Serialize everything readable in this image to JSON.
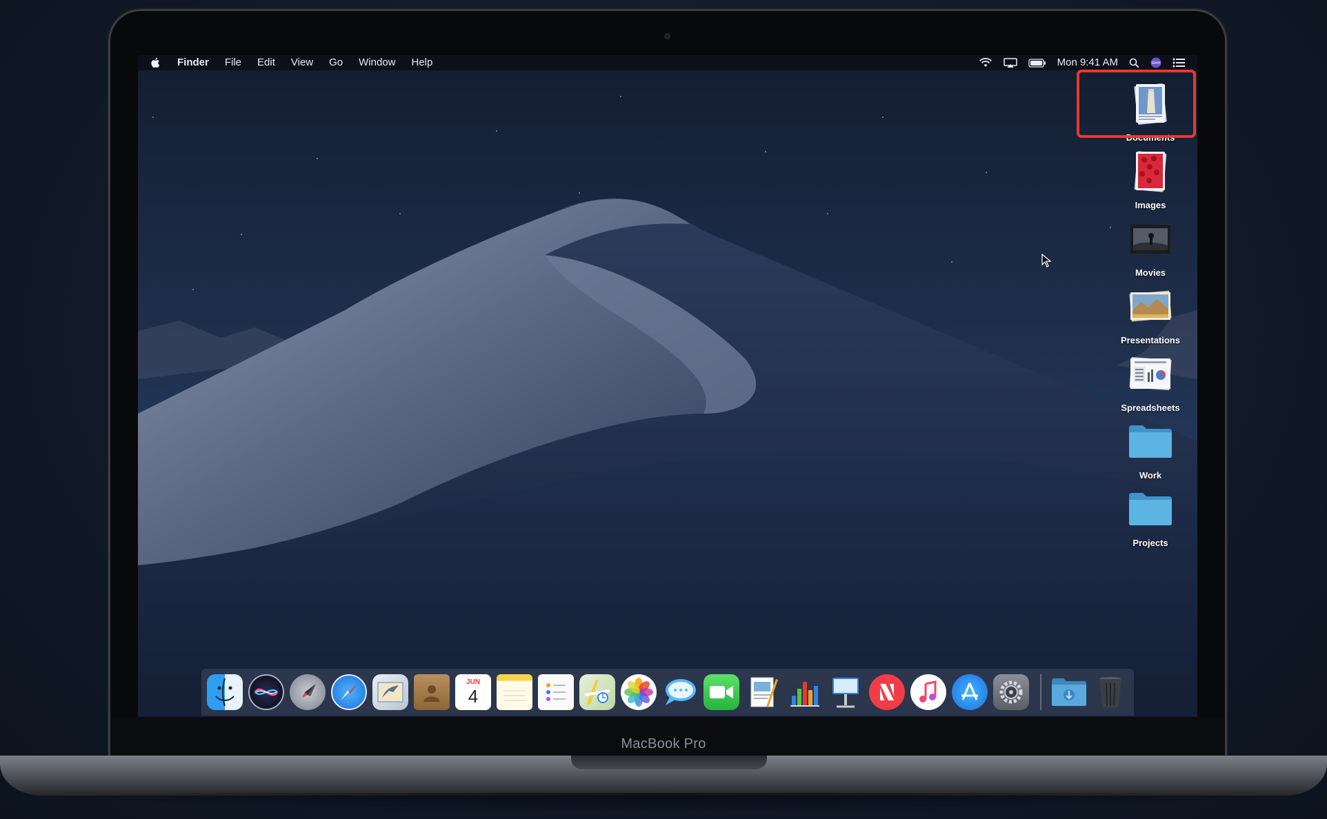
{
  "menubar": {
    "apple_icon": "apple-logo-icon",
    "app_name": "Finder",
    "menus": [
      "File",
      "Edit",
      "View",
      "Go",
      "Window",
      "Help"
    ],
    "status_icons": [
      "wifi-icon",
      "airplay-icon",
      "battery-icon"
    ],
    "clock": "Mon 9:41 AM",
    "right_icons": [
      "spotlight-search-icon",
      "siri-icon",
      "notification-center-icon"
    ]
  },
  "desktop": {
    "items": [
      {
        "label": "Documents",
        "icon": "documents-stack-icon",
        "selected": true
      },
      {
        "label": "Images",
        "icon": "images-stack-icon"
      },
      {
        "label": "Movies",
        "icon": "movies-stack-icon"
      },
      {
        "label": "Presentations",
        "icon": "presentations-stack-icon"
      },
      {
        "label": "Spreadsheets",
        "icon": "spreadsheets-stack-icon"
      },
      {
        "label": "Work",
        "icon": "folder-icon"
      },
      {
        "label": "Projects",
        "icon": "folder-icon"
      }
    ],
    "highlight_color": "#e8392a"
  },
  "dock": {
    "apps": [
      "finder-icon",
      "siri-icon",
      "launchpad-icon",
      "safari-icon",
      "mail-icon",
      "contacts-icon",
      "calendar-icon",
      "notes-icon",
      "reminders-icon",
      "maps-icon",
      "photos-icon",
      "messages-icon",
      "facetime-icon",
      "pages-icon",
      "numbers-icon",
      "keynote-icon",
      "news-icon",
      "itunes-icon",
      "app-store-icon",
      "system-preferences-icon"
    ],
    "calendar": {
      "month": "JUN",
      "day": "4"
    },
    "right": [
      "downloads-folder-icon",
      "trash-icon"
    ]
  },
  "device_label": "MacBook Pro"
}
